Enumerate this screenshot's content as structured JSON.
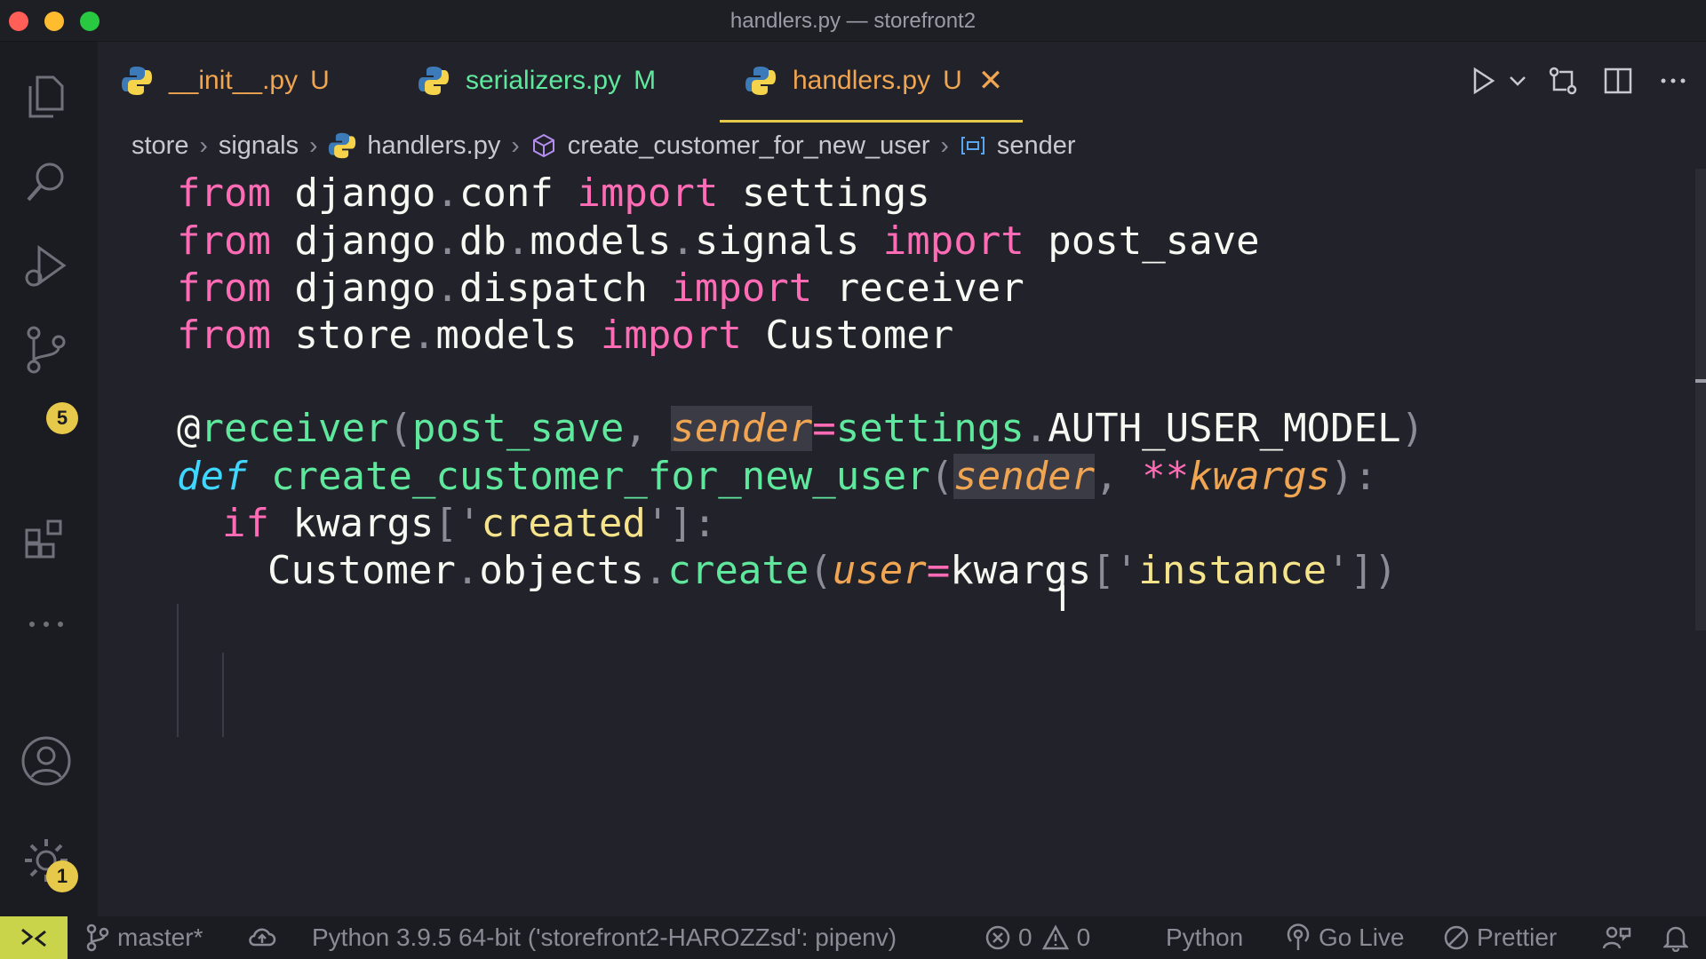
{
  "window": {
    "title": "handlers.py — storefront2"
  },
  "colors": {
    "accent": "#e6c84a",
    "remote": "#c9d44b",
    "keyword": "#ff6bb5",
    "function": "#5fe89d",
    "string": "#f5e48a",
    "param": "#f0a552",
    "keyword_italic": "#3fd6ff"
  },
  "activity_bar": {
    "items": [
      {
        "name": "explorer-icon"
      },
      {
        "name": "search-icon"
      },
      {
        "name": "run-debug-icon"
      },
      {
        "name": "source-control-icon",
        "badge": "5"
      },
      {
        "name": "extensions-icon"
      },
      {
        "name": "more-icon"
      }
    ],
    "bottom": [
      {
        "name": "account-icon"
      },
      {
        "name": "settings-gear-icon",
        "badge": "1"
      }
    ]
  },
  "tabs": [
    {
      "label": "__init__.py",
      "status": "U",
      "color": "#f0a552",
      "status_color": "#f0a552"
    },
    {
      "label": "serializers.py",
      "status": "M",
      "color": "#5fe89d",
      "status_color": "#5fe89d"
    },
    {
      "label": "handlers.py",
      "status": "U",
      "color": "#f0a552",
      "status_color": "#f0a552",
      "active": true,
      "close": "✕"
    }
  ],
  "breadcrumb": [
    "store",
    "signals",
    "handlers.py",
    "create_customer_for_new_user",
    "sender"
  ],
  "code": {
    "line1": {
      "kw": "from",
      "mod": "django",
      "dot": ".",
      "mod2": "conf",
      "imp": "import",
      "name": "settings"
    },
    "line2": {
      "kw": "from",
      "mod": "django",
      "d1": ".",
      "m2": "db",
      "d2": ".",
      "m3": "models",
      "d3": ".",
      "m4": "signals",
      "imp": "import",
      "name": "post_save"
    },
    "line3": {
      "kw": "from",
      "mod": "django",
      "dot": ".",
      "mod2": "dispatch",
      "imp": "import",
      "name": "receiver"
    },
    "line4": {
      "kw": "from",
      "mod": "store",
      "dot": ".",
      "mod2": "models",
      "imp": "import",
      "name": "Customer"
    },
    "line6": {
      "at": "@",
      "dec": "receiver",
      "open": "(",
      "arg1": "post_save",
      "comma": ", ",
      "param": "sender",
      "eq": "=",
      "val": "settings",
      "dot": ".",
      "attr": "AUTH_USER_MODEL",
      "close": ")"
    },
    "line7": {
      "def": "def",
      "fname": "create_customer_for_new_user",
      "open": "(",
      "p1": "sender",
      "comma": ", ",
      "stars": "**",
      "p2": "kwargs",
      "close": "):"
    },
    "line8": {
      "kw": "if",
      "var": "kwargs",
      "ob": "[",
      "q1": "'",
      "s": "created",
      "q2": "'",
      "cb": "]:"
    },
    "line9": {
      "cls": "Customer",
      "d1": ".",
      "obj": "objects",
      "d2": ".",
      "fn": "create",
      "open": "(",
      "param": "user",
      "eq": "=",
      "var": "kwargs",
      "ob": "[",
      "q1": "'",
      "s": "instance",
      "q2": "'",
      "cb": "])"
    }
  },
  "statusbar": {
    "branch": "master*",
    "interpreter": "Python 3.9.5 64-bit ('storefront2-HAROZZsd': pipenv)",
    "errors": "0",
    "warnings": "0",
    "language": "Python",
    "go_live": "Go Live",
    "prettier": "Prettier"
  }
}
